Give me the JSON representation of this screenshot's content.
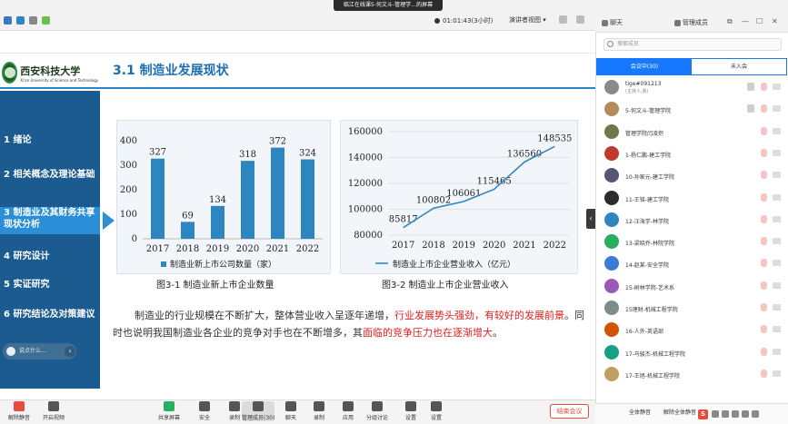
{
  "window": {
    "title": "临江在线课5-何文斗-管理学…的屏幕",
    "timer": "01:01:43(3小时)",
    "view_label": "演讲者视图",
    "theme_colors": {
      "nav": "#1b5b8f",
      "nav_active": "#2a8fd7",
      "title": "#1d6fb0",
      "accent": "#1677ff",
      "end": "#e74c3c"
    }
  },
  "slide": {
    "logo_cn": "西安科技大学",
    "logo_en": "Xi'an University of Science and Technology",
    "title": "3.1 制造业发展现状",
    "nav": [
      {
        "label": "1 绪论",
        "active": false
      },
      {
        "label": "2 相关概念及理论基础",
        "active": false
      },
      {
        "label": "3 制造业及其财务共享现状分析",
        "active": true
      },
      {
        "label": "4 研究设计",
        "active": false
      },
      {
        "label": "5 实证研究",
        "active": false
      },
      {
        "label": "6 研究结论及对策建议",
        "active": false
      }
    ],
    "chat_prompt": "说点什么…",
    "caption1": "图3-1  制造业新上市企业数量",
    "caption2": "图3-2  制造业上市企业营业收入",
    "paragraph": {
      "p1": "制造业的行业规模在不断扩大，整体营业收入呈逐年递增，",
      "p2_red": "行业发展势头强劲，有较好的发展前景",
      "p3": "。同时也说明我国制造业各企业的竞争对手也在不断增多，其",
      "p4_red": "面临的竞争压力也在逐渐增大",
      "p5": "。"
    }
  },
  "chart_data": [
    {
      "type": "bar",
      "categories": [
        "2017",
        "2018",
        "2019",
        "2020",
        "2021",
        "2022"
      ],
      "values": [
        327,
        69,
        134,
        318,
        372,
        324
      ],
      "ylim": [
        0,
        400
      ],
      "yticks": [
        0,
        100,
        200,
        300,
        400
      ],
      "legend": "制造业新上市公司数量（家）",
      "legend_position": "bottom",
      "color": "#2e86c1",
      "grid": false
    },
    {
      "type": "line",
      "categories": [
        "2017",
        "2018",
        "2019",
        "2020",
        "2021",
        "2022"
      ],
      "values": [
        85817,
        100802,
        106061,
        115465,
        136560,
        148535
      ],
      "ylim": [
        80000,
        160000
      ],
      "yticks": [
        80000,
        100000,
        120000,
        140000,
        160000
      ],
      "legend": "制造业上市企业营业收入（亿元）",
      "legend_position": "bottom",
      "color": "#2e86c1",
      "grid": true
    }
  ],
  "toolbar": {
    "buttons": [
      {
        "label": "解除静音",
        "name": "unmute-button",
        "icon": "mic-icon",
        "color": "#e74c3c"
      },
      {
        "label": "开启视频",
        "name": "start-video-button",
        "icon": "camera-icon",
        "color": "#555555"
      },
      {
        "label": "共享屏幕",
        "name": "share-screen-button",
        "icon": "share-icon",
        "color": "#27ae60"
      },
      {
        "label": "安全",
        "name": "security-button",
        "icon": "shield-icon",
        "color": "#555555"
      },
      {
        "label": "录制",
        "name": "record-button",
        "icon": "record-icon",
        "color": "#555555"
      },
      {
        "label": "管理成员(30)",
        "name": "manage-members-button",
        "icon": "members-icon",
        "color": "#555555"
      },
      {
        "label": "聊天",
        "name": "chat-button",
        "icon": "chat-icon",
        "color": "#555555"
      },
      {
        "label": "录制",
        "name": "record2-button",
        "icon": "record-icon",
        "color": "#555555"
      },
      {
        "label": "应用",
        "name": "apps-button",
        "icon": "apps-icon",
        "color": "#555555"
      },
      {
        "label": "分组讨论",
        "name": "breakout-button",
        "icon": "group-icon",
        "color": "#555555"
      },
      {
        "label": "设置",
        "name": "settings-button",
        "icon": "gear-icon",
        "color": "#555555"
      },
      {
        "label": "设置",
        "name": "settings2-button",
        "icon": "gear-icon",
        "color": "#555555"
      }
    ],
    "end_label": "结束会议"
  },
  "right_panel": {
    "tab_chat": "聊天",
    "tab_members": "管理成员",
    "search_placeholder": "搜索成员",
    "tab_in_meeting": "会议中(30)",
    "tab_not_joined": "未入会",
    "participants": [
      {
        "name": "tige#091213",
        "sub": "(主持人,我)",
        "color": "#8a8a8a",
        "mic_on": true
      },
      {
        "name": "5-何文斗-管理学院",
        "color": "#b58b5a",
        "mic_on": true
      },
      {
        "name": "管理学院闫凌炽",
        "color": "#6a7a4a"
      },
      {
        "name": "1-杨仁鹏-建工学院",
        "color": "#c0392b"
      },
      {
        "name": "10-孙家元-建工学院",
        "color": "#555577"
      },
      {
        "name": "11-王铭-建工学院",
        "color": "#2c2c2c"
      },
      {
        "name": "12-汪海学-林学院",
        "color": "#2e86c1"
      },
      {
        "name": "13-梁晓乔-林院学院",
        "color": "#27ae60"
      },
      {
        "name": "14-赵某-安全学院",
        "color": "#3a7bd5"
      },
      {
        "name": "15-树林学院-艺术系",
        "color": "#9b59b6"
      },
      {
        "name": "15理财-机械工程学院",
        "color": "#7f8c8d"
      },
      {
        "name": "16-人外-英语部",
        "color": "#d35400"
      },
      {
        "name": "17-马骏杰-机械工程学院",
        "color": "#16a085"
      },
      {
        "name": "17-王旭-机械工程学院",
        "color": "#c0a060"
      }
    ],
    "btn_mute_all": "全体静音",
    "btn_unmute_all": "解除全体静音"
  }
}
